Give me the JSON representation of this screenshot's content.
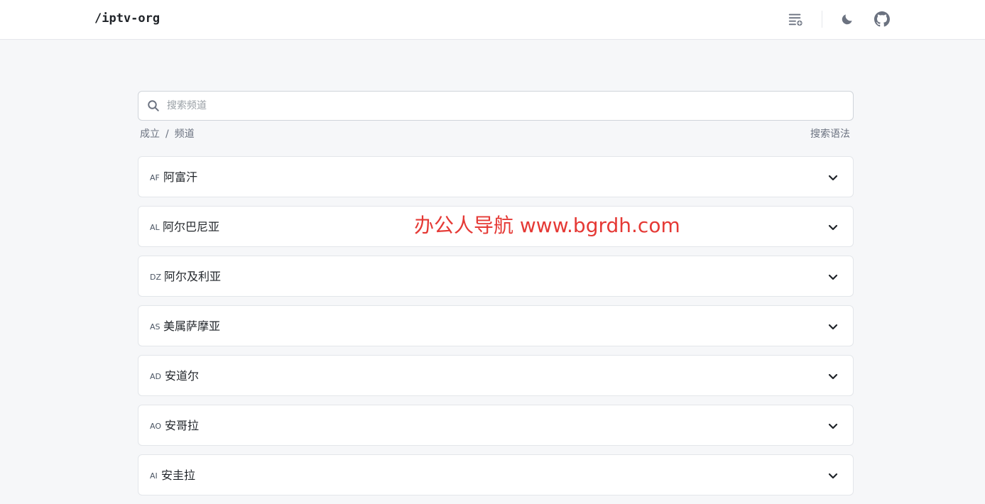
{
  "header": {
    "logo": "/iptv-org",
    "icons": [
      "playlist-add-icon",
      "moon-icon",
      "github-icon"
    ]
  },
  "search": {
    "placeholder": "搜索频道",
    "value": ""
  },
  "breadcrumb": {
    "root": "成立",
    "separator": "/",
    "current": "频道"
  },
  "syntax_link": "搜索语法",
  "countries": [
    {
      "code": "AF",
      "name": "阿富汗"
    },
    {
      "code": "AL",
      "name": "阿尔巴尼亚"
    },
    {
      "code": "DZ",
      "name": "阿尔及利亚"
    },
    {
      "code": "AS",
      "name": "美属萨摩亚"
    },
    {
      "code": "AD",
      "name": "安道尔"
    },
    {
      "code": "AO",
      "name": "安哥拉"
    },
    {
      "code": "AI",
      "name": "安圭拉"
    }
  ],
  "watermark": "办公人导航 www.bgrdh.com",
  "colors": {
    "background": "#f6f7f9",
    "card": "#ffffff",
    "text": "#1f2328",
    "muted": "#6b7280",
    "watermark": "#e53935"
  }
}
